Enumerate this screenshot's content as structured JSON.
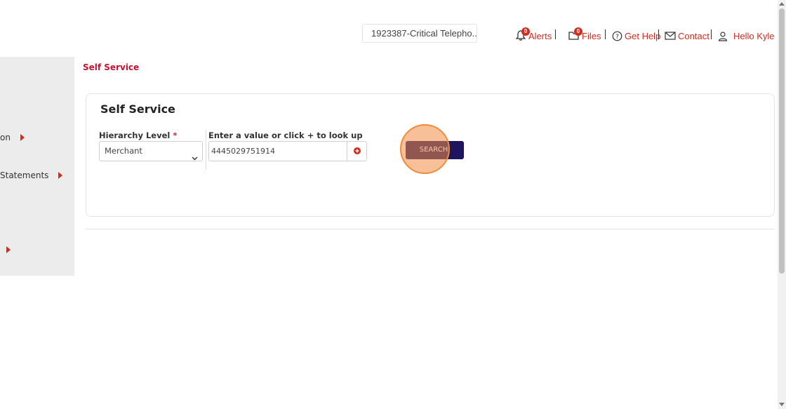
{
  "header": {
    "account_selector": "1923387-Critical Telepho...",
    "alerts": {
      "label": "Alerts",
      "count": "0"
    },
    "files": {
      "label": "Files",
      "count": "0"
    },
    "help_label": "Get Help",
    "contact_label": "Contact",
    "user_greeting": "Hello Kyle"
  },
  "sidebar": {
    "items": [
      {
        "label": "on"
      },
      {
        "label": "Statements"
      },
      {
        "label": ""
      }
    ]
  },
  "breadcrumb": "Self Service",
  "card": {
    "title": "Self Service",
    "hierarchy_label": "Hierarchy Level",
    "required_mark": "*",
    "hierarchy_value": "Merchant",
    "lookup_label": "Enter a value or click + to look up",
    "lookup_value": "4445029751914",
    "search_label": "SEARCH"
  },
  "colors": {
    "accent": "#d52b1e",
    "button": "#1f145e",
    "highlight": "#f08c3a"
  }
}
